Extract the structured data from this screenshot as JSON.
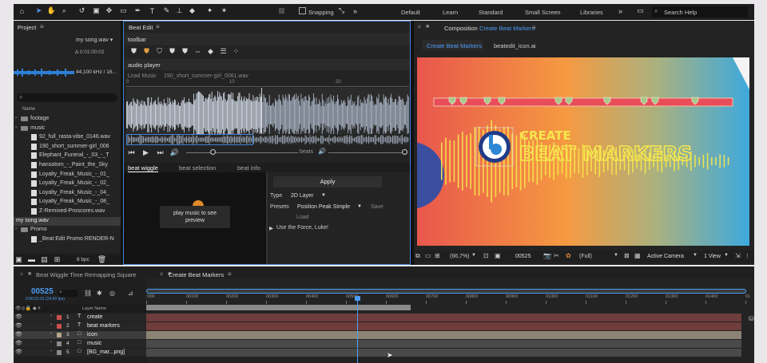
{
  "workspaces": [
    "Default",
    "Learn",
    "Standard",
    "Small Screen",
    "Libraries"
  ],
  "snapping_label": "Snapping",
  "search_placeholder": "Search Help",
  "project": {
    "title": "Project",
    "selected_name": "my song.wav ▾",
    "duration": "Δ 0:01:00:02",
    "audio_info": "44,100 kHz / 16...",
    "column_name": "Name",
    "bpc": "8 bpc",
    "items": [
      {
        "name": "footage",
        "type": "folder",
        "indent": 0
      },
      {
        "name": "music",
        "type": "folder",
        "indent": 0
      },
      {
        "name": "92_full_rasta-vibe_0146.wav",
        "type": "file",
        "indent": 1
      },
      {
        "name": "190_short_summer-girl_006",
        "type": "file",
        "indent": 1
      },
      {
        "name": "Elephant_Funeral_-_03_-_T",
        "type": "file",
        "indent": 1
      },
      {
        "name": "hansatom_-_Paint_the_Sky",
        "type": "file",
        "indent": 1
      },
      {
        "name": "Loyalty_Freak_Music_-_01_",
        "type": "file",
        "indent": 1
      },
      {
        "name": "Loyalty_Freak_Music_-_02_",
        "type": "file",
        "indent": 1
      },
      {
        "name": "Loyalty_Freak_Music_-_04_",
        "type": "file",
        "indent": 1
      },
      {
        "name": "Loyalty_Freak_Music_-_08_",
        "type": "file",
        "indent": 1
      },
      {
        "name": "Z-Remixed-Proscores.wav",
        "type": "file",
        "indent": 1
      },
      {
        "name": "my song.wav",
        "type": "file",
        "indent": 0,
        "selected": true
      },
      {
        "name": "Promo",
        "type": "folder",
        "indent": 0
      },
      {
        "name": "_Beat Edit Promo RENDER-N",
        "type": "file",
        "indent": 1
      }
    ]
  },
  "beatedit": {
    "title": "Beat Edit",
    "toolbar_label": "toolbar",
    "audio_player_label": "audio player",
    "load_music": "Load Music",
    "file_name": "190_short_summer-girl_0061.wav",
    "ticks": [
      "0",
      "10",
      "20"
    ],
    "beats_label": "beats",
    "tabs": [
      "beat wiggle",
      "beat selection",
      "beat info"
    ],
    "preview_text": "play music to see preview",
    "apply_label": "Apply",
    "type_label": "Type",
    "type_value": "2D Layer",
    "presets_label": "Presets",
    "presets_value": "Position Peak Simple",
    "save_label": "Save",
    "load_label": "Load",
    "force_label": "Use the Force, Luke!"
  },
  "composition": {
    "title_prefix": "Composition",
    "title_name": "Create Beat Markers",
    "tabs": [
      "Create Beat Markers",
      "beatedit_icon.ai"
    ],
    "create_text": "CREATE",
    "beat_text": "BEAT MARKERS",
    "zoom": "(66,7%)",
    "frame": "00525",
    "resolution": "(Full)",
    "camera": "Active Camera",
    "view": "1 View"
  },
  "timeline": {
    "tabs": [
      "Beat Wiggle Time Remapping Square",
      "Create Beat Markers"
    ],
    "timecode": "00525",
    "timecode_sub": "0:00:21:01 (24.00 fps)",
    "col_layer_name": "Layer Name",
    "ruler": [
      ":000",
      "00100",
      "00200",
      "00300",
      "00400",
      "00500",
      "00600",
      "00700",
      "00800",
      "00900",
      "01000",
      "01100",
      "01200",
      "01300",
      "01400",
      "01"
    ],
    "layers": [
      {
        "num": "1",
        "kind": "T",
        "name": "create",
        "color": "#c9504b",
        "bar": "#6e3d3c"
      },
      {
        "num": "2",
        "kind": "T",
        "name": "beat markers",
        "color": "#c9504b",
        "bar": "#6e3d3c"
      },
      {
        "num": "3",
        "kind": "□",
        "name": "icon",
        "color": "#b8a78a",
        "bar": "#8d8375",
        "selected": true
      },
      {
        "num": "4",
        "kind": "□",
        "name": "music",
        "color": "#8a8a8a",
        "bar": "#4a4a4a"
      },
      {
        "num": "5",
        "kind": "□",
        "name": "[BG_mar...png]",
        "color": "#8a8a8a",
        "bar": "#4a4a4a"
      }
    ]
  },
  "colors": {
    "accent": "#2d8ceb",
    "panel": "#232323",
    "timecode": "#4c9cf0"
  }
}
